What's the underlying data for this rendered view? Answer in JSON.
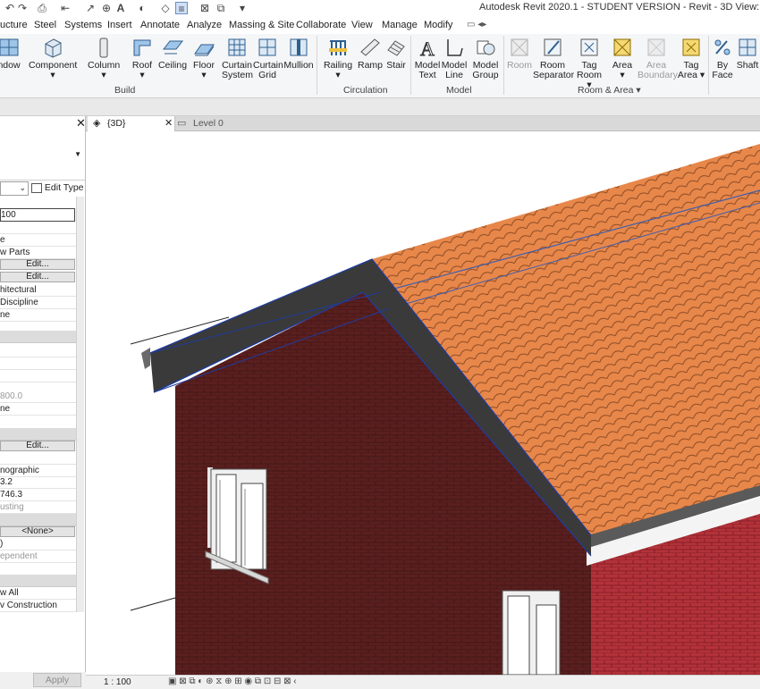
{
  "app": {
    "title": "Autodesk Revit 2020.1 - STUDENT VERSION - Revit - 3D View: {3D}"
  },
  "tabs": [
    "ucture",
    "Steel",
    "Systems",
    "Insert",
    "Annotate",
    "Analyze",
    "Massing & Site",
    "Collaborate",
    "View",
    "Manage",
    "Modify"
  ],
  "ribbon": {
    "buttons": [
      {
        "label1": "ndow",
        "label2": "",
        "icon": "window-icon"
      },
      {
        "label1": "Component",
        "label2": "▾",
        "icon": "component-icon"
      },
      {
        "label1": "Column",
        "label2": "▾",
        "icon": "column-icon"
      },
      {
        "label1": "Roof",
        "label2": "▾",
        "icon": "roof-icon"
      },
      {
        "label1": "Ceiling",
        "label2": "",
        "icon": "ceiling-icon"
      },
      {
        "label1": "Floor",
        "label2": "▾",
        "icon": "floor-icon"
      },
      {
        "label1": "Curtain",
        "label2": "System",
        "icon": "curtain-system-icon"
      },
      {
        "label1": "Curtain",
        "label2": "Grid",
        "icon": "curtain-grid-icon"
      },
      {
        "label1": "Mullion",
        "label2": "",
        "icon": "mullion-icon"
      },
      {
        "label1": "Railing",
        "label2": "▾",
        "icon": "railing-icon"
      },
      {
        "label1": "Ramp",
        "label2": "",
        "icon": "ramp-icon"
      },
      {
        "label1": "Stair",
        "label2": "",
        "icon": "stair-icon"
      },
      {
        "label1": "Model",
        "label2": "Text",
        "icon": "model-text-icon"
      },
      {
        "label1": "Model",
        "label2": "Line",
        "icon": "model-line-icon"
      },
      {
        "label1": "Model",
        "label2": "Group",
        "icon": "model-group-icon"
      },
      {
        "label1": "Room",
        "label2": "",
        "icon": "room-icon"
      },
      {
        "label1": "Room",
        "label2": "Separator",
        "icon": "room-separator-icon"
      },
      {
        "label1": "Tag",
        "label2": "Room ▾",
        "icon": "tag-room-icon"
      },
      {
        "label1": "Area",
        "label2": "▾",
        "icon": "area-icon"
      },
      {
        "label1": "Area",
        "label2": "Boundary",
        "icon": "area-boundary-icon"
      },
      {
        "label1": "Tag",
        "label2": "Area ▾",
        "icon": "tag-area-icon"
      },
      {
        "label1": "By",
        "label2": "Face",
        "icon": "by-face-icon"
      },
      {
        "label1": "Shaft",
        "label2": "",
        "icon": "shaft-icon"
      }
    ],
    "panels": [
      "Build",
      "Circulation",
      "Model",
      "Room & Area ▾"
    ]
  },
  "properties": {
    "edit_type": "Edit Type",
    "name_value": "100",
    "rows": [
      {
        "text": "e",
        "grey": false
      },
      {
        "text": "w Parts",
        "grey": false
      },
      {
        "text": "Edit...",
        "button": true
      },
      {
        "text": "Edit...",
        "button": true
      },
      {
        "text": "hitectural",
        "grey": false
      },
      {
        "text": "Discipline",
        "grey": false
      },
      {
        "text": "ne",
        "grey": false
      }
    ],
    "rows2": [
      {
        "text": "",
        "grey": false
      },
      {
        "text": "",
        "grey": false
      },
      {
        "text": "",
        "grey": false
      },
      {
        "text": "800.0",
        "grey": true
      },
      {
        "text": "ne",
        "grey": false
      }
    ],
    "rows3": [
      {
        "text": "Edit...",
        "button": true
      },
      {
        "text": "",
        "grey": false
      },
      {
        "text": "nographic",
        "grey": false
      },
      {
        "text": "3.2",
        "grey": false
      },
      {
        "text": "746.3",
        "grey": false
      },
      {
        "text": "usting",
        "grey": true
      }
    ],
    "rows4": [
      {
        "text": "<None>",
        "button": true
      },
      {
        "text": ")",
        "grey": false
      },
      {
        "text": "ependent",
        "grey": true
      }
    ],
    "rows5": [
      {
        "text": "w All",
        "grey": false
      },
      {
        "text": "v Construction",
        "grey": false
      }
    ],
    "apply": "Apply"
  },
  "view_tabs": {
    "active": "{3D}",
    "other": "Level 0"
  },
  "status": {
    "scale": "1 : 100"
  },
  "colors": {
    "roof_tile": "#e8874a",
    "brick_dark": "#5a1f1f",
    "brick_red": "#b3323a",
    "selection": "#1f3c9c",
    "fascia": "#3a3a3a"
  }
}
